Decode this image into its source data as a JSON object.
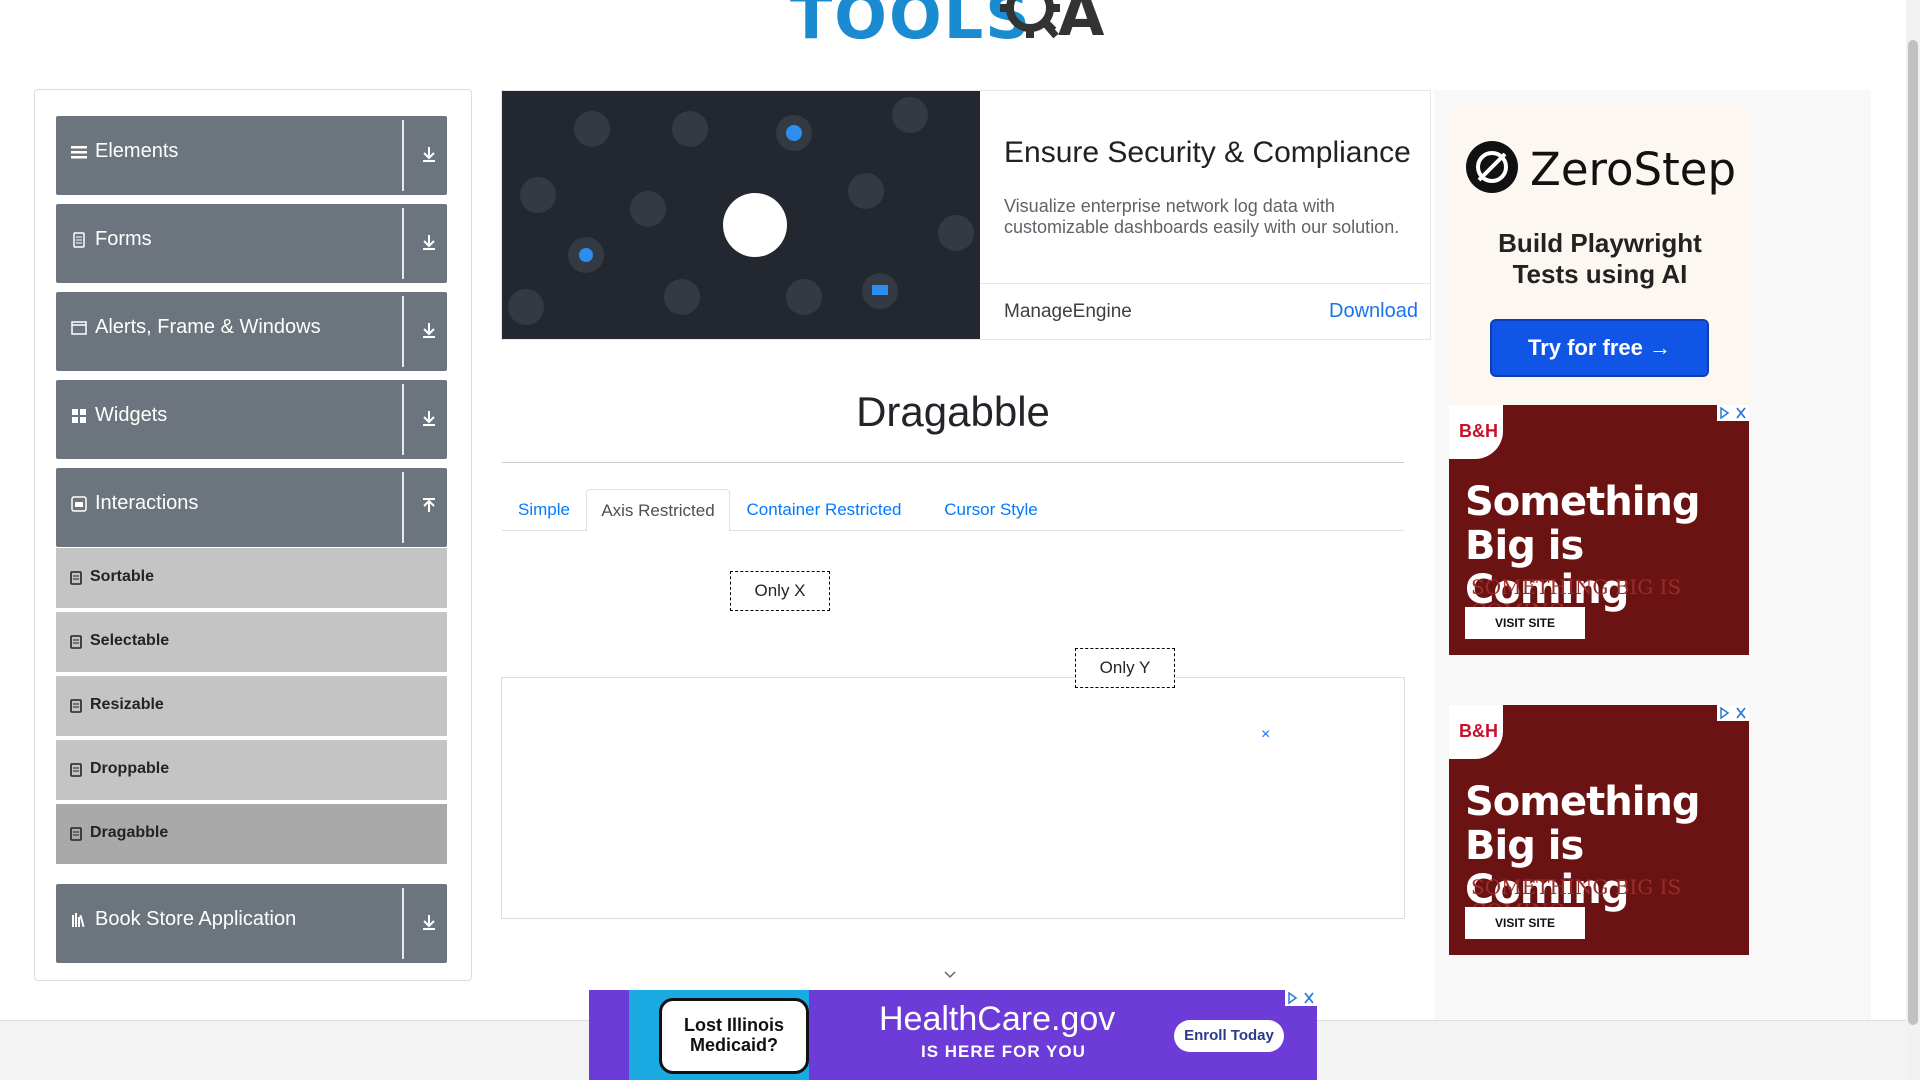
{
  "colors": {
    "brand_blue": "#1a8bd0",
    "sidebar_group": "#6c757d",
    "sidebar_sub": "#c4c4c4",
    "sidebar_sub_active": "#a9a9a9",
    "link": "#007bff"
  },
  "header": {
    "logo_text": "TOOLS",
    "logo_suffix": "A"
  },
  "sidebar": {
    "groups": [
      {
        "label": "Elements",
        "icon": "hamburger-icon",
        "arrow": "download-arrow-icon"
      },
      {
        "label": "Forms",
        "icon": "document-icon",
        "arrow": "download-arrow-icon"
      },
      {
        "label": "Alerts, Frame & Windows",
        "icon": "window-icon",
        "arrow": "download-arrow-icon"
      },
      {
        "label": "Widgets",
        "icon": "grid-icon",
        "arrow": "download-arrow-icon"
      },
      {
        "label": "Interactions",
        "icon": "stack-icon",
        "arrow": "upload-arrow-icon"
      },
      {
        "label": "Book Store Application",
        "icon": "books-icon",
        "arrow": "download-arrow-icon"
      }
    ],
    "interactions_items": [
      "Sortable",
      "Selectable",
      "Resizable",
      "Droppable",
      "Dragabble"
    ],
    "active_item": "Dragabble"
  },
  "top_ad": {
    "title": "Ensure Security & Compliance",
    "description": "Visualize enterprise network log data with customizable dashboards easily with our solution.",
    "brand": "ManageEngine",
    "cta": "Download"
  },
  "main": {
    "title": "Dragabble",
    "tabs": [
      "Simple",
      "Axis Restricted",
      "Container Restricted",
      "Cursor Style"
    ],
    "active_tab": "Axis Restricted",
    "only_x": "Only X",
    "only_y": "Only Y",
    "ad_close": "×"
  },
  "right_ads": {
    "zerostep": {
      "name": "ZeroStep",
      "tagline_1": "Build Playwright",
      "tagline_2": "Tests using AI",
      "button": "Try for free →"
    },
    "bh": {
      "logo": "B&H",
      "headline_1": "Something",
      "headline_2": "Big is Coming",
      "ghost": "SOMETHING BIG IS COMING",
      "button": "VISIT SITE"
    }
  },
  "bottom_ad": {
    "note": "Lost Illinois Medicaid?",
    "brand": "HealthCare.gov",
    "subtitle": "IS HERE FOR YOU",
    "button": "Enroll Today"
  }
}
